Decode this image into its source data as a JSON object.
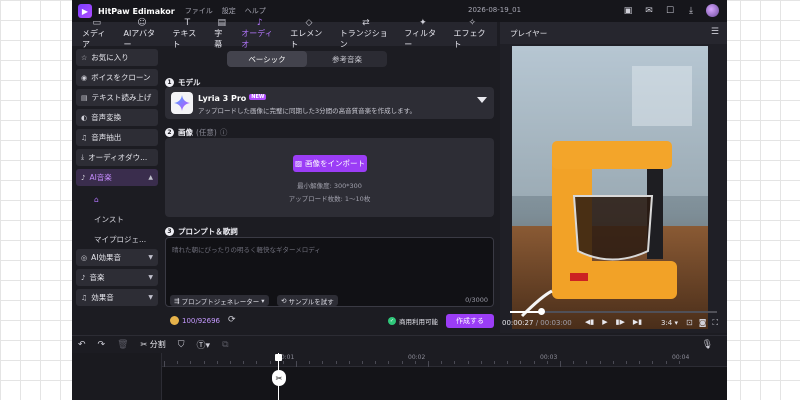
{
  "titlebar": {
    "app_name": "HitPaw Edimakor",
    "menu": [
      "ファイル",
      "設定",
      "ヘルプ"
    ],
    "project_date": "2026-08-19_01"
  },
  "toolbar": {
    "tools": [
      {
        "label": "メディア",
        "icon": "folder-icon"
      },
      {
        "label": "AIアバター",
        "icon": "ai-avatar-icon"
      },
      {
        "label": "テキスト",
        "icon": "text-icon"
      },
      {
        "label": "字幕",
        "icon": "subtitle-icon"
      },
      {
        "label": "オーディオ",
        "icon": "music-note-icon",
        "active": true
      },
      {
        "label": "エレメント",
        "icon": "element-icon"
      },
      {
        "label": "トランジション",
        "icon": "transition-icon"
      },
      {
        "label": "フィルター",
        "icon": "filter-icon"
      },
      {
        "label": "エフェクト",
        "icon": "effect-icon"
      }
    ]
  },
  "sidebar": {
    "items": [
      {
        "label": "お気に入り",
        "icon": "star-icon"
      },
      {
        "label": "ボイスをクローン",
        "icon": "voice-clone-icon"
      },
      {
        "label": "テキスト読み上げ",
        "icon": "tts-icon"
      },
      {
        "label": "音声変換",
        "icon": "voice-changer-icon"
      },
      {
        "label": "音声抽出",
        "icon": "extract-icon"
      },
      {
        "label": "オーディオダウ...",
        "icon": "download-icon"
      },
      {
        "label": "AI音楽",
        "icon": "ai-music-icon",
        "active": true
      }
    ],
    "sub_items": [
      "インスト",
      "マイプロジェ..."
    ],
    "bottom_items": [
      {
        "label": "AI効果音",
        "icon": "ai-sfx-icon"
      },
      {
        "label": "音楽",
        "icon": "music-icon"
      },
      {
        "label": "効果音",
        "icon": "sfx-icon"
      }
    ]
  },
  "panel": {
    "tabs": [
      "ベーシック",
      "参考音楽"
    ],
    "section1_title": "モデル",
    "model_name": "Lyria 3 Pro",
    "new_badge": "NEW",
    "model_desc": "アップロードした画像に完璧に同期した3分間の高音質音楽を作成します。",
    "section2_title": "画像",
    "section2_optional": "(任意)",
    "import_label": "画像をインポート",
    "min_resolution": "最小解像度: 300*300",
    "upload_count": "アップロード枚数: 1～10枚",
    "section3_title": "プロンプト＆歌詞",
    "prompt_placeholder": "晴れた朝にぴったりの明るく軽快なギターメロディ",
    "prompt_generator_label": "プロンプトジェネレーター",
    "try_sample_label": "サンプルを試す",
    "char_count": "0/3000"
  },
  "bottom": {
    "credits": "100/92696",
    "commercial": "商用利用可能",
    "generate_label": "作成する"
  },
  "player": {
    "title": "プレイヤー",
    "current_time": "00:00:27",
    "total_time": "/ 00:03:00",
    "ratio": "3:4",
    "progress": 0.15
  },
  "timeline_toolbar": {
    "split_label": "分割"
  },
  "ruler": [
    "00:00",
    "00:01",
    "00:02",
    "00:03",
    "00:04"
  ]
}
